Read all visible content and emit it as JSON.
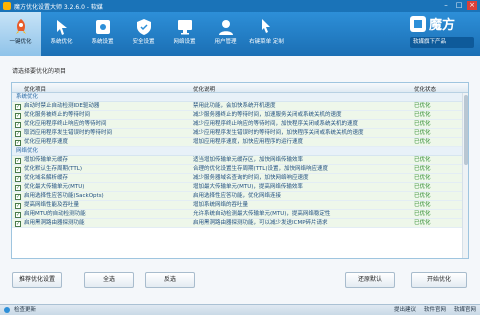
{
  "window": {
    "title": "魔方优化设置大师 3.2.6.0 - 软媒",
    "min": "–",
    "max": "□",
    "close": "×"
  },
  "nav": [
    {
      "label": "一键优化",
      "icon": "rocket-icon",
      "active": true
    },
    {
      "label": "系统优化",
      "icon": "cursor-icon",
      "active": false
    },
    {
      "label": "系统设置",
      "icon": "gear-icon",
      "active": false
    },
    {
      "label": "安全设置",
      "icon": "shield-icon",
      "active": false
    },
    {
      "label": "网络设置",
      "icon": "network-icon",
      "active": false
    },
    {
      "label": "用户管理",
      "icon": "user-icon",
      "active": false
    },
    {
      "label": "右键菜单 定制",
      "icon": "context-menu-icon",
      "active": false
    }
  ],
  "brand": {
    "name": "魔方",
    "download": "软媒旗下产品"
  },
  "prompt": "请选择要优化的项目",
  "columns": {
    "item": "优化项目",
    "desc": "优化说明",
    "state": "优化状态"
  },
  "groups": [
    {
      "name": "系统优化",
      "rows": [
        {
          "item": "启动时禁止自动检测IDE驱动器",
          "desc": "禁用此功能，会加快系统开机速度",
          "state": "已优化"
        },
        {
          "item": "优化服务被终止的等待时间",
          "desc": "减少服务器终止的等待时间，加速服务关闭或系统关机的速度",
          "state": "已优化"
        },
        {
          "item": "优化应用程序终止响应的等待时间",
          "desc": "减少应用程序终止响应的等待时间，加快程序关闭或系统关机的速度",
          "state": "已优化"
        },
        {
          "item": "取消应用程序发生错误时的等待时间",
          "desc": "减少应用程序发生错误时的等待时间，加快程序关闭或系统关机的速度",
          "state": "已优化"
        },
        {
          "item": "优化应用程序速度",
          "desc": "增加应用程序速度，加快应用程序的运行速度",
          "state": "已优化"
        }
      ]
    },
    {
      "name": "网络优化",
      "rows": [
        {
          "item": "增加传输单元缓存",
          "desc": "适当增加传输单元缓存区，加快网络传输效率",
          "state": "已优化"
        },
        {
          "item": "优化默认生存周期(TTL)",
          "desc": "合理的优化设置生存周期(TTL)设置，加快网络响应速度",
          "state": "已优化"
        },
        {
          "item": "优化域名解析缓存",
          "desc": "减少服务器域名查询的时间，加快网络响应速度",
          "state": "已优化"
        },
        {
          "item": "优化最大传输单元(MTU)",
          "desc": "增加最大传输单元(MTU)，提高网络传输效率",
          "state": "已优化"
        },
        {
          "item": "启用选择性应答功能(SackOpts)",
          "desc": "启用选择性应答功能，优化网络连接",
          "state": "已优化"
        },
        {
          "item": "提高网络性能及吞吐量",
          "desc": "增加系统网络的吞吐量",
          "state": "已优化"
        },
        {
          "item": "启用MTU的自动检测功能",
          "desc": "允许系统自动检测最大传输单元(MTU)，提高网络稳定性",
          "state": "已优化"
        },
        {
          "item": "启用黑洞路由器探测功能",
          "desc": "启用黑洞路由器探测功能，可以减少发送ICMP碎片请求",
          "state": "已优化"
        }
      ]
    }
  ],
  "buttons": {
    "recommend": "推荐优化设置",
    "select_all": "全选",
    "invert": "反选",
    "restore": "还原默认",
    "start": "开始优化"
  },
  "status": {
    "update": "检查更新",
    "feedback": "提出建议",
    "forum": "软件官网",
    "site": "软媒官网"
  }
}
